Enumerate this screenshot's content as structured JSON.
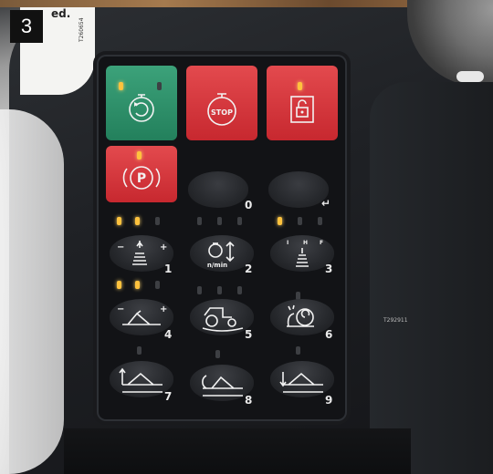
{
  "figure_number": "3",
  "sticker_text": "ed.",
  "sticker_code": "T260654",
  "bezel_code": "T292911",
  "keys": {
    "stop_label": "STOP",
    "park_label": "P",
    "blank_key_0": "0",
    "blank_key_enter": "↵",
    "hitch_1_label": "1",
    "hitch_1_minus": "−",
    "hitch_1_plus": "+",
    "engine_speed_label": "n/min",
    "engine_speed_num": "2",
    "pto_num": "3",
    "pto_marks": [
      "I",
      "H",
      "F"
    ],
    "hitch_4_num": "4",
    "hitch_4_minus": "−",
    "hitch_4_plus": "+",
    "tractor_num": "5",
    "creep_num": "6",
    "lift_7_num": "7",
    "lift_8_num": "8",
    "lift_9_num": "9"
  },
  "colors": {
    "green_key": "#2f9268",
    "red_key": "#d6373c",
    "led_on": "#ffc23d",
    "led_off": "#3d3f43"
  }
}
